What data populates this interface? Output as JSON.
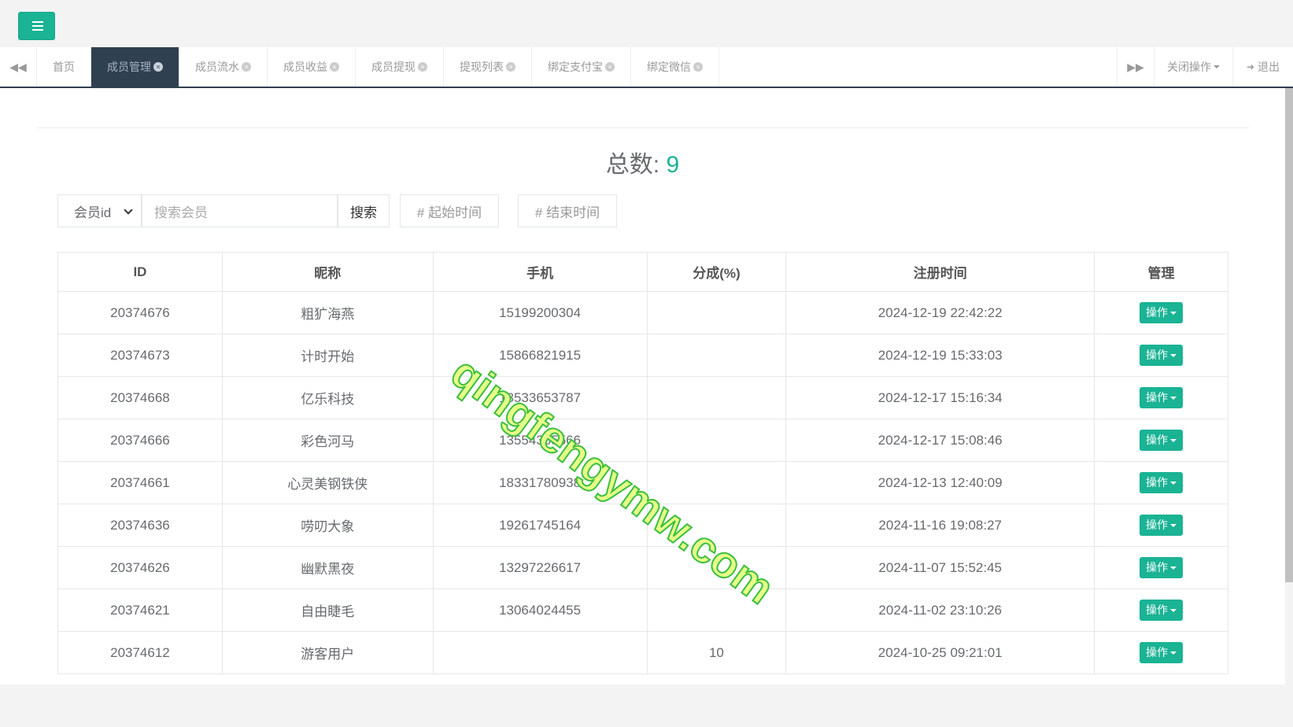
{
  "topbar": {
    "menu_icon": "hamburger-icon"
  },
  "tabs": {
    "items": [
      {
        "label": "首页",
        "closable": false,
        "active": false
      },
      {
        "label": "成员管理",
        "closable": true,
        "active": true
      },
      {
        "label": "成员流水",
        "closable": true,
        "active": false
      },
      {
        "label": "成员收益",
        "closable": true,
        "active": false
      },
      {
        "label": "成员提现",
        "closable": true,
        "active": false
      },
      {
        "label": "提现列表",
        "closable": true,
        "active": false
      },
      {
        "label": "绑定支付宝",
        "closable": true,
        "active": false
      },
      {
        "label": "绑定微信",
        "closable": true,
        "active": false
      }
    ],
    "close_ops_label": "关闭操作",
    "logout_label": "退出"
  },
  "summary": {
    "label": "总数: ",
    "count": "9"
  },
  "search": {
    "select_value": "会员id",
    "placeholder": "搜索会员",
    "button_label": "搜索",
    "start_placeholder": "# 起始时间",
    "end_placeholder": "# 结束时间"
  },
  "table": {
    "headers": [
      "ID",
      "昵称",
      "手机",
      "分成(%)",
      "注册时间",
      "管理"
    ],
    "action_label": "操作",
    "rows": [
      {
        "id": "20374676",
        "nickname": "粗犷海燕",
        "phone": "15199200304",
        "share": "",
        "time": "2024-12-19 22:42:22"
      },
      {
        "id": "20374673",
        "nickname": "计时开始",
        "phone": "15866821915",
        "share": "",
        "time": "2024-12-19 15:33:03"
      },
      {
        "id": "20374668",
        "nickname": "亿乐科技",
        "phone": "18533653787",
        "share": "",
        "time": "2024-12-17 15:16:34"
      },
      {
        "id": "20374666",
        "nickname": "彩色河马",
        "phone": "13554365566",
        "share": "",
        "time": "2024-12-17 15:08:46"
      },
      {
        "id": "20374661",
        "nickname": "心灵美钢铁侠",
        "phone": "18331780938",
        "share": "",
        "time": "2024-12-13 12:40:09"
      },
      {
        "id": "20374636",
        "nickname": "唠叨大象",
        "phone": "19261745164",
        "share": "",
        "time": "2024-11-16 19:08:27"
      },
      {
        "id": "20374626",
        "nickname": "幽默黑夜",
        "phone": "13297226617",
        "share": "",
        "time": "2024-11-07 15:52:45"
      },
      {
        "id": "20374621",
        "nickname": "自由睫毛",
        "phone": "13064024455",
        "share": "",
        "time": "2024-11-02 23:10:26"
      },
      {
        "id": "20374612",
        "nickname": "游客用户",
        "phone": "",
        "share": "10",
        "time": "2024-10-25 09:21:01"
      }
    ]
  },
  "watermark": "qingfengymw.com",
  "colors": {
    "accent": "#1ab394",
    "active_tab": "#2f4050"
  }
}
